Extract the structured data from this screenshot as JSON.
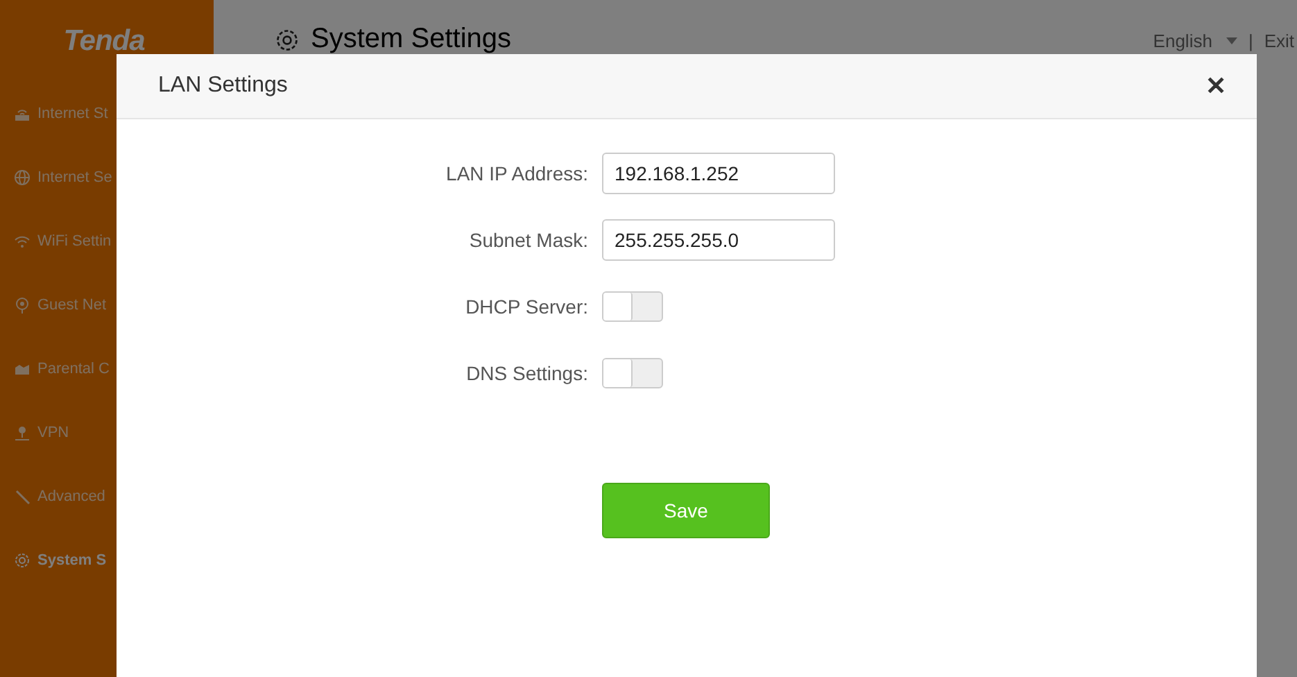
{
  "brand": {
    "logo": "Tenda"
  },
  "sidebar": {
    "items": [
      {
        "label": "Internet St",
        "selected": false
      },
      {
        "label": "Internet Se",
        "selected": false
      },
      {
        "label": "WiFi Settin",
        "selected": false
      },
      {
        "label": "Guest Net",
        "selected": false
      },
      {
        "label": "Parental C",
        "selected": false
      },
      {
        "label": "VPN",
        "selected": false
      },
      {
        "label": "Advanced",
        "selected": false
      },
      {
        "label": "System S",
        "selected": true
      }
    ]
  },
  "header": {
    "title": "System Settings",
    "language": "English",
    "separator": "|",
    "exit": "Exit"
  },
  "dialog": {
    "title": "LAN Settings",
    "close": "✕",
    "fields": [
      {
        "kind": "input",
        "label": "LAN IP Address:",
        "value": "192.168.1.252"
      },
      {
        "kind": "input",
        "label": "Subnet Mask:",
        "value": "255.255.255.0"
      },
      {
        "kind": "toggle",
        "label": "DHCP Server:",
        "on": false
      },
      {
        "kind": "toggle",
        "label": "DNS Settings:",
        "on": false
      }
    ],
    "save": "Save"
  }
}
